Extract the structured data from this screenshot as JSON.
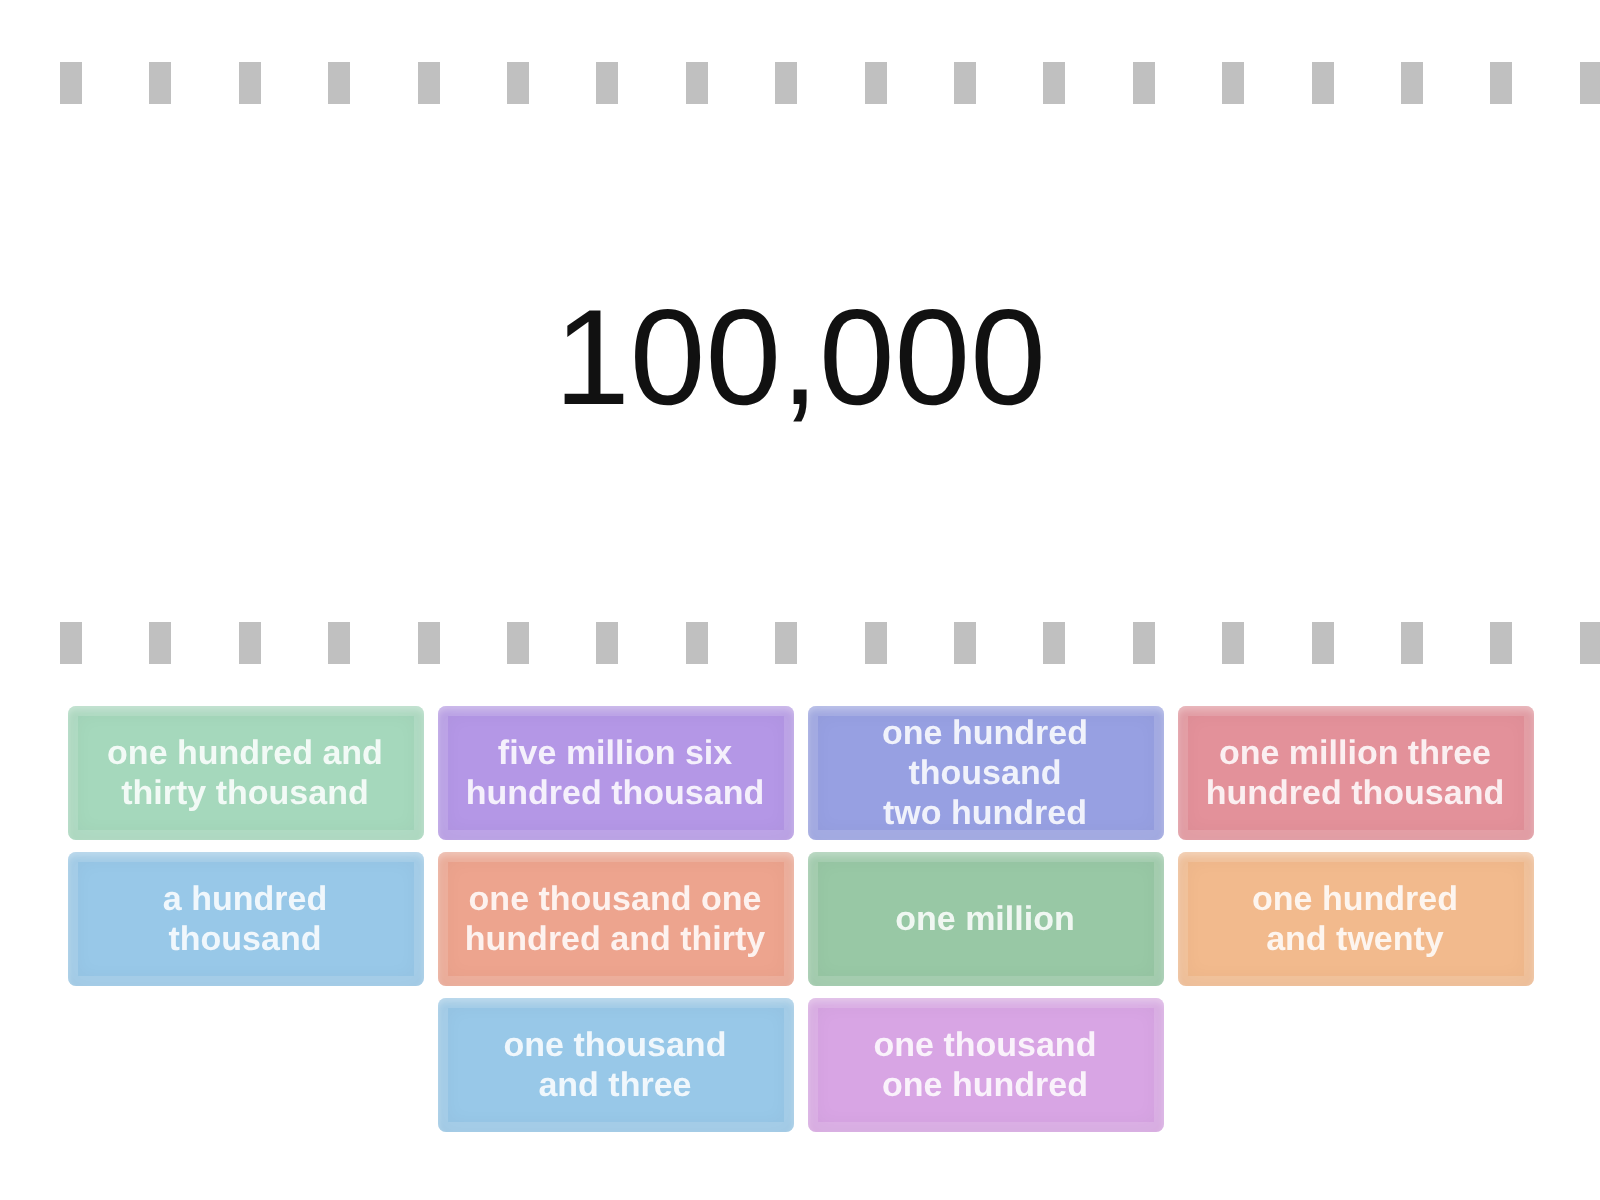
{
  "prompt": "100,000",
  "tiles": [
    {
      "text": "one hundred and\nthirty thousand",
      "color": "#a5d8bc"
    },
    {
      "text": "five million six\nhundred thousand",
      "color": "#b497e6"
    },
    {
      "text": "one hundred\nthousand\ntwo hundred",
      "color": "#97a0e2"
    },
    {
      "text": "one million three\nhundred thousand",
      "color": "#e3919a"
    },
    {
      "text": "a hundred\nthousand",
      "color": "#98c8e8"
    },
    {
      "text": "one thousand one\nhundred and thirty",
      "color": "#eda48e"
    },
    {
      "text": "one million",
      "color": "#98c8a5"
    },
    {
      "text": "one hundred\nand twenty",
      "color": "#f2ba8d"
    },
    {
      "text": "one thousand\nand three",
      "color": "#98c8e8"
    },
    {
      "text": "one thousand\none hundred",
      "color": "#d8a5e4"
    }
  ]
}
